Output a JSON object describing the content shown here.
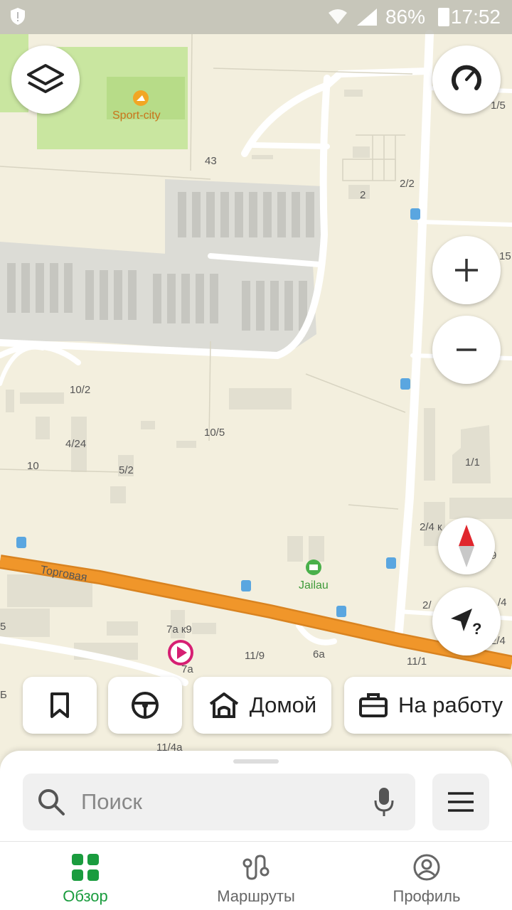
{
  "status_bar": {
    "battery": "86%",
    "time": "17:52"
  },
  "map": {
    "poi": [
      {
        "name": "Sport-city"
      },
      {
        "name": "Jailau"
      }
    ],
    "street_label": "Торговая",
    "house_numbers": {
      "n43": "43",
      "n2_2": "2/2",
      "n2": "2",
      "n1_5": "1/5",
      "n15": "15",
      "n10_2": "10/2",
      "n10_5": "10/5",
      "n4_24": "4/24",
      "n10": "10",
      "n5_2": "5/2",
      "n1_1": "1/1",
      "n2_4k": "2/4 к",
      "n9": "9",
      "n2_": "2/",
      "n4": "/4",
      "n2_4": "2/4",
      "n5": "5",
      "n7ak9": "7а к9",
      "n11_9": "11/9",
      "n6a": "6а",
      "n11_1": "11/1",
      "n7a": "7а",
      "n11_4a": "11/4а",
      "nB": "Б"
    }
  },
  "chips": {
    "home_label": "Домой",
    "work_label": "На работу"
  },
  "search": {
    "placeholder": "Поиск"
  },
  "tabs": [
    {
      "label": "Обзор",
      "active": true
    },
    {
      "label": "Маршруты",
      "active": false
    },
    {
      "label": "Профиль",
      "active": false
    }
  ],
  "colors": {
    "accent": "#1a9c3e",
    "road": "#f0962a",
    "map_bg": "#f3efde",
    "park": "#c9e6a0"
  }
}
